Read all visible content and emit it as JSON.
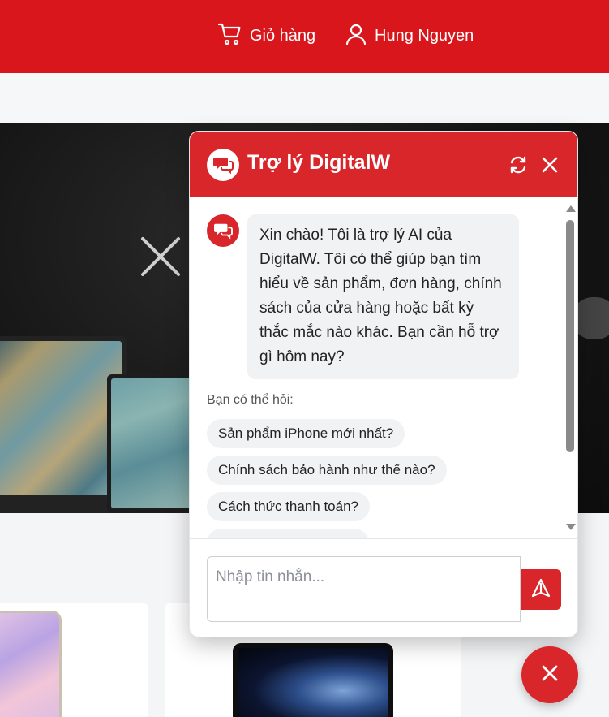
{
  "header": {
    "cart_label": "Giỏ hàng",
    "user_name": "Hung Nguyen"
  },
  "chat": {
    "title": "Trợ lý DigitalW",
    "greeting": "Xin chào! Tôi là trợ lý AI của DigitalW. Tôi có thể giúp bạn tìm hiểu về sản phẩm, đơn hàng, chính sách của cửa hàng hoặc bất kỳ thắc mắc nào khác. Bạn cần hỗ trợ gì hôm nay?",
    "suggestions_label": "Bạn có thể hỏi:",
    "suggestions": [
      "Sản phẩm iPhone mới nhất?",
      "Chính sách bảo hành như thế nào?",
      "Cách thức thanh toán?",
      ""
    ],
    "input_placeholder": "Nhập tin nhắn...",
    "input_value": ""
  },
  "icons": {
    "cart": "cart-icon",
    "user": "user-icon",
    "bot": "chat-bubble-icon",
    "refresh": "refresh-icon",
    "close": "close-icon",
    "send": "send-icon"
  },
  "colors": {
    "brand_red": "#d8161b",
    "chat_red": "#d8262b",
    "bubble_bg": "#f1f2f4"
  }
}
